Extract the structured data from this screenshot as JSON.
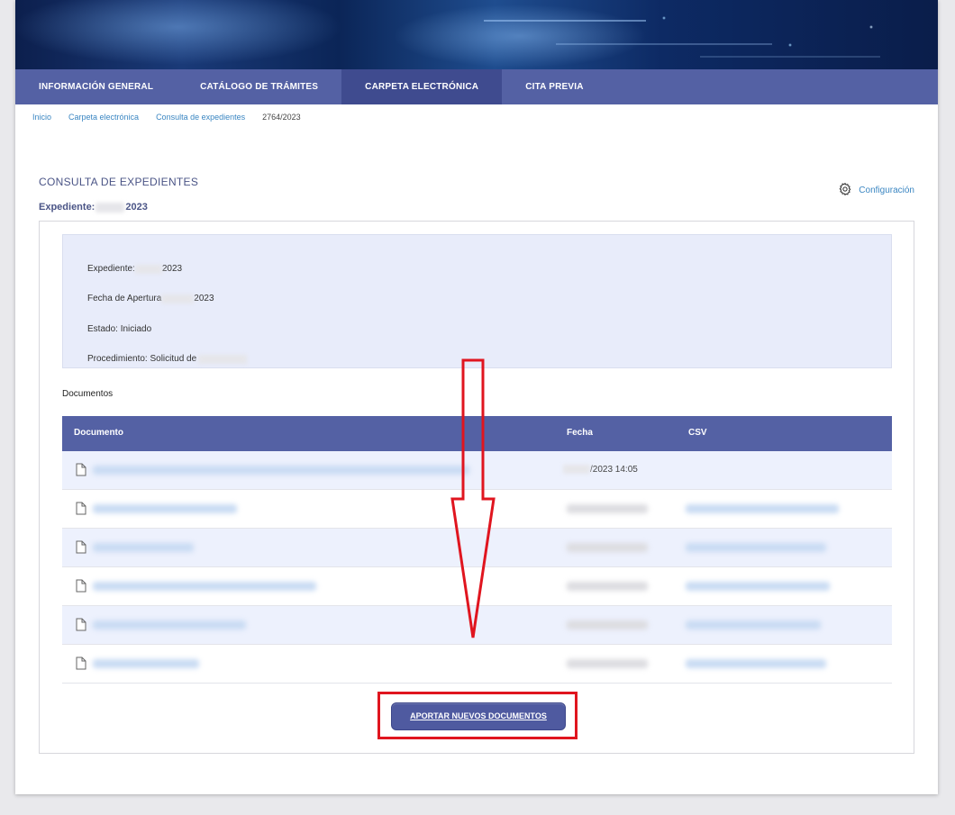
{
  "nav": {
    "items": [
      {
        "label": "INFORMACIÓN GENERAL",
        "active": false
      },
      {
        "label": "CATÁLOGO DE TRÁMITES",
        "active": false
      },
      {
        "label": "CARPETA ELECTRÓNICA",
        "active": true
      },
      {
        "label": "CITA PREVIA",
        "active": false
      }
    ]
  },
  "breadcrumb": {
    "items": [
      "Inicio",
      "Carpeta electrónica",
      "Consulta de expedientes"
    ],
    "current": "2764/2023"
  },
  "page": {
    "title": "CONSULTA DE EXPEDIENTES",
    "expediente_label": "Expediente:",
    "expediente_value": "2023",
    "config_label": "Configuración"
  },
  "info": {
    "expediente_label": "Expediente:",
    "expediente_value": "2023",
    "fecha_label": "Fecha de Apertura",
    "fecha_value": "2023",
    "estado": "Estado: Iniciado",
    "procedimiento": "Procedimiento: Solicitud de"
  },
  "documents": {
    "heading": "Documentos",
    "columns": [
      "Documento",
      "Fecha",
      "CSV"
    ],
    "rows": [
      {
        "fecha": "/2023 14:05"
      },
      {
        "fecha": ""
      },
      {
        "fecha": ""
      },
      {
        "fecha": ""
      },
      {
        "fecha": ""
      },
      {
        "fecha": ""
      }
    ]
  },
  "actions": {
    "add_documents_label": "APORTAR NUEVOS DOCUMENTOS"
  },
  "colors": {
    "nav_bg": "#5461a4",
    "nav_active": "#3f4b8f",
    "link": "#3a86c2",
    "info_bg": "#e8ecfa",
    "annotation_red": "#e0151f"
  }
}
